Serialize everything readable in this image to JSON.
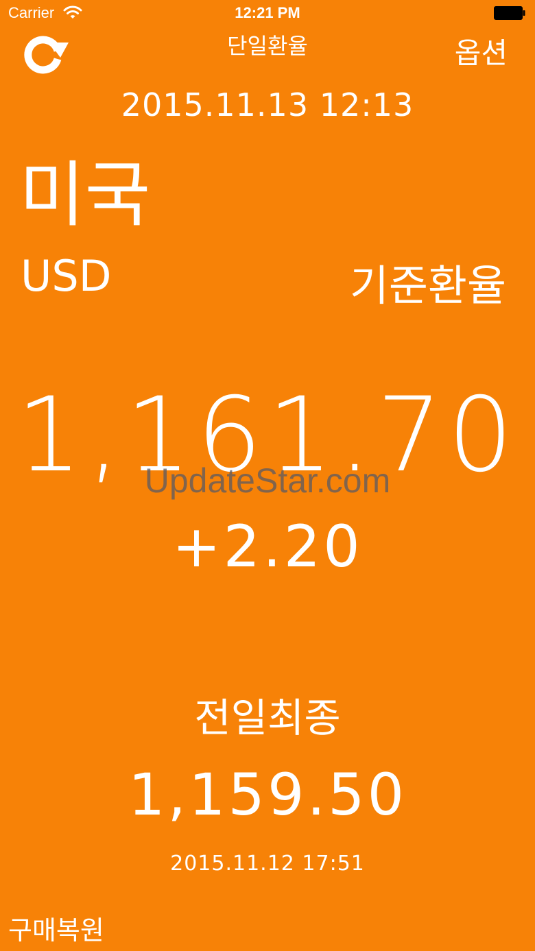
{
  "status_bar": {
    "carrier": "Carrier",
    "time": "12:21 PM",
    "wifi_icon": "wifi-icon",
    "battery_icon": "battery-icon"
  },
  "nav": {
    "refresh_icon": "refresh-icon",
    "title": "단일환율",
    "options_label": "옵션"
  },
  "rate": {
    "timestamp": "2015.11.13 12:13",
    "country": "미국",
    "currency_code": "USD",
    "rate_type": "기준환율",
    "value": "1,161.70",
    "change": "+2.20"
  },
  "watermark": "UpdateStar.com",
  "previous": {
    "label": "전일최종",
    "value": "1,159.50",
    "timestamp": "2015.11.12 17:51"
  },
  "footer": {
    "restore_purchase_label": "구매복원"
  },
  "colors": {
    "background": "#F78207",
    "foreground": "#FFFFFF"
  }
}
